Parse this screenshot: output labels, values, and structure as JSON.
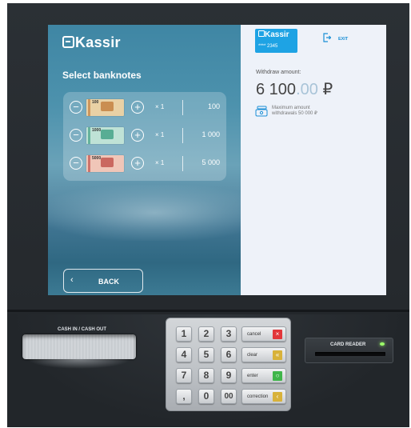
{
  "brand": {
    "name": "Kassir",
    "mark": "e"
  },
  "left": {
    "title": "Select banknotes",
    "banknotes": [
      {
        "denomination_label": "100",
        "count": "× 1",
        "amount": "100",
        "note_color": "#e9d1a5",
        "accent": "#c27d3c"
      },
      {
        "denomination_label": "1000",
        "count": "× 1",
        "amount": "1 000",
        "note_color": "#bfe2d6",
        "accent": "#3ea083"
      },
      {
        "denomination_label": "5000",
        "count": "× 1",
        "amount": "5 000",
        "note_color": "#f0c6b8",
        "accent": "#c0504a"
      }
    ],
    "minus_symbol": "−",
    "plus_symbol": "+",
    "back": {
      "label": "BACK",
      "chevron": "‹"
    }
  },
  "right": {
    "card": {
      "brand": "Kassir",
      "number": "**** 2345",
      "color": "#1ea3e4"
    },
    "exit_label": "EXIT",
    "withdraw_label": "Withdraw amount:",
    "withdraw_amount_int": "6 100",
    "withdraw_amount_dec": ".00",
    "currency": "₽",
    "max_text": "Maximum amount withdrawals 50 000 ₽"
  },
  "hardware": {
    "cash_slot_label": "CASH IN / CASH OUT",
    "card_reader_label": "CARD READER",
    "keys": [
      "1",
      "2",
      "3",
      "4",
      "5",
      "6",
      "7",
      "8",
      "9",
      ",",
      "0",
      "00"
    ],
    "function_keys": [
      {
        "label": "cancel",
        "icon": "×",
        "color": "#e2363a"
      },
      {
        "label": "clear",
        "icon": "«",
        "color": "#d8b23a"
      },
      {
        "label": "enter",
        "icon": "○",
        "color": "#3fb54a"
      },
      {
        "label": "correction",
        "icon": "‹",
        "color": "#d8b23a"
      }
    ]
  },
  "colors": {
    "accent": "#1a8fd6",
    "screen_bg": "#eef2f9"
  }
}
